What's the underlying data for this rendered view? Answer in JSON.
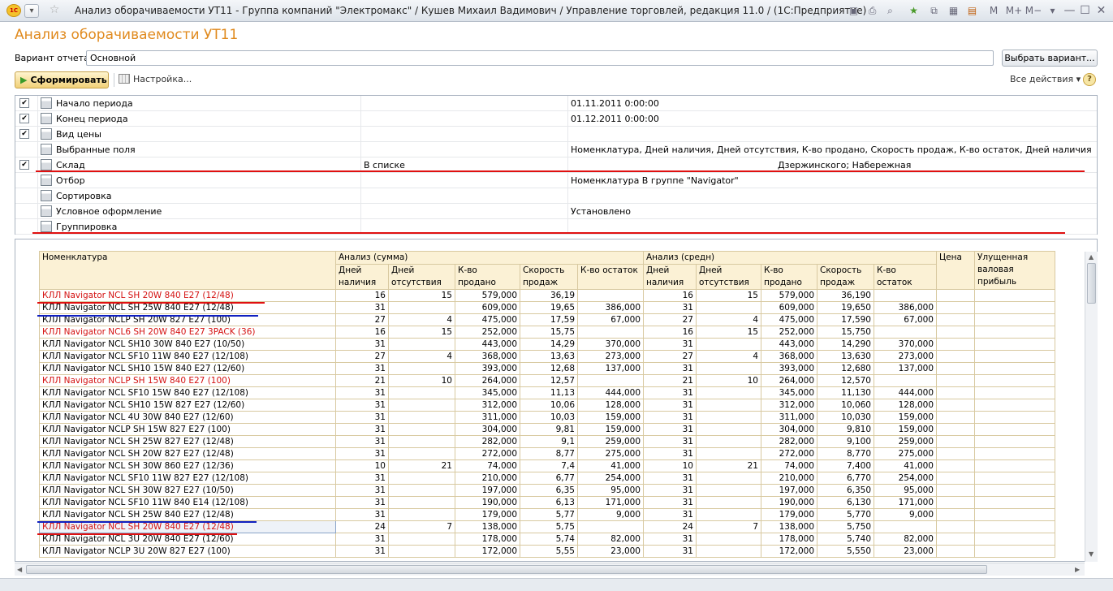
{
  "window": {
    "title": "Анализ оборачиваемости УТ11 - Группа компаний \"Электромакс\" / Кушев Михаил Вадимович / Управление торговлей, редакция 11.0 / (1С:Предприятие)",
    "logo": "1С"
  },
  "form": {
    "heading": "Анализ оборачиваемости УТ11",
    "variant_label": "Вариант отчета:",
    "variant_value": "Основной",
    "choose_variant": "Выбрать вариант...",
    "generate": "Сформировать",
    "setup": "Настройка...",
    "all_actions": "Все действия ▾",
    "help": "?"
  },
  "settings": [
    {
      "checked": true,
      "name": "Начало периода",
      "mid": "",
      "value": "01.11.2011 0:00:00",
      "value2": ""
    },
    {
      "checked": true,
      "name": "Конец периода",
      "mid": "",
      "value": "01.12.2011 0:00:00",
      "value2": ""
    },
    {
      "checked": true,
      "name": "Вид цены",
      "mid": "",
      "value": "",
      "value2": ""
    },
    {
      "checked": null,
      "name": "Выбранные поля",
      "mid": "",
      "value": "Номенклатура, Дней наличия, Дней отсутствия, К-во продано, Скорость продаж, К-во остаток, Дней наличия, Дней отсутст...",
      "value2": ""
    },
    {
      "checked": true,
      "name": "Склад",
      "mid": "В списке",
      "value": "",
      "value2": "Дзержинского; Набережная"
    },
    {
      "checked": null,
      "name": "Отбор",
      "mid": "",
      "value": "Номенклатура В группе \"Navigator\"",
      "value2": ""
    },
    {
      "checked": null,
      "name": "Сортировка",
      "mid": "",
      "value": "",
      "value2": ""
    },
    {
      "checked": null,
      "name": "Условное оформление",
      "mid": "",
      "value": "Установлено",
      "value2": ""
    },
    {
      "checked": null,
      "name": "Группировка",
      "mid": "",
      "value": "",
      "value2": ""
    }
  ],
  "report": {
    "header": {
      "nomenclature": "Номенклатура",
      "group_sum": "Анализ (сумма)",
      "group_avg": "Анализ (средн)",
      "price": "Цена",
      "gross": "Улущенная валовая прибыль",
      "days_in": "Дней наличия",
      "days_out": "Дней отсутствия",
      "sold": "К-во продано",
      "speed": "Скорость продаж",
      "rest": "К-во остаток"
    },
    "rows": [
      {
        "name": "КЛЛ Navigator NCL SH 20W 840 E27 (12/48)",
        "red": true,
        "d1": "16",
        "o1": "15",
        "s1": "579,000",
        "v1": "36,19",
        "r1": "",
        "d2": "16",
        "o2": "15",
        "s2": "579,000",
        "v2": "36,190",
        "r2": ""
      },
      {
        "name": "КЛЛ Navigator NCL SH 25W 840 E27 (12/48)",
        "red": false,
        "d1": "31",
        "o1": "",
        "s1": "609,000",
        "v1": "19,65",
        "r1": "386,000",
        "d2": "31",
        "o2": "",
        "s2": "609,000",
        "v2": "19,650",
        "r2": "386,000"
      },
      {
        "name": "КЛЛ Navigator NCLP SH 20W 827 E27 (100)",
        "red": false,
        "d1": "27",
        "o1": "4",
        "s1": "475,000",
        "v1": "17,59",
        "r1": "67,000",
        "d2": "27",
        "o2": "4",
        "s2": "475,000",
        "v2": "17,590",
        "r2": "67,000"
      },
      {
        "name": "КЛЛ Navigator NCL6 SH 20W 840 E27 3PACK (36)",
        "red": true,
        "d1": "16",
        "o1": "15",
        "s1": "252,000",
        "v1": "15,75",
        "r1": "",
        "d2": "16",
        "o2": "15",
        "s2": "252,000",
        "v2": "15,750",
        "r2": ""
      },
      {
        "name": "КЛЛ Navigator NCL SH10 30W 840 E27 (10/50)",
        "red": false,
        "d1": "31",
        "o1": "",
        "s1": "443,000",
        "v1": "14,29",
        "r1": "370,000",
        "d2": "31",
        "o2": "",
        "s2": "443,000",
        "v2": "14,290",
        "r2": "370,000"
      },
      {
        "name": "КЛЛ Navigator NCL SF10 11W 840 E27 (12/108)",
        "red": false,
        "d1": "27",
        "o1": "4",
        "s1": "368,000",
        "v1": "13,63",
        "r1": "273,000",
        "d2": "27",
        "o2": "4",
        "s2": "368,000",
        "v2": "13,630",
        "r2": "273,000"
      },
      {
        "name": "КЛЛ Navigator NCL SH10 15W 840 E27 (12/60)",
        "red": false,
        "d1": "31",
        "o1": "",
        "s1": "393,000",
        "v1": "12,68",
        "r1": "137,000",
        "d2": "31",
        "o2": "",
        "s2": "393,000",
        "v2": "12,680",
        "r2": "137,000"
      },
      {
        "name": "КЛЛ Navigator NCLP SH 15W 840 E27 (100)",
        "red": true,
        "d1": "21",
        "o1": "10",
        "s1": "264,000",
        "v1": "12,57",
        "r1": "",
        "d2": "21",
        "o2": "10",
        "s2": "264,000",
        "v2": "12,570",
        "r2": ""
      },
      {
        "name": "КЛЛ Navigator NCL SF10 15W 840 E27 (12/108)",
        "red": false,
        "d1": "31",
        "o1": "",
        "s1": "345,000",
        "v1": "11,13",
        "r1": "444,000",
        "d2": "31",
        "o2": "",
        "s2": "345,000",
        "v2": "11,130",
        "r2": "444,000"
      },
      {
        "name": "КЛЛ Navigator NCL SH10 15W 827 E27 (12/60)",
        "red": false,
        "d1": "31",
        "o1": "",
        "s1": "312,000",
        "v1": "10,06",
        "r1": "128,000",
        "d2": "31",
        "o2": "",
        "s2": "312,000",
        "v2": "10,060",
        "r2": "128,000"
      },
      {
        "name": "КЛЛ Navigator NCL 4U 30W 840 E27 (12/60)",
        "red": false,
        "d1": "31",
        "o1": "",
        "s1": "311,000",
        "v1": "10,03",
        "r1": "159,000",
        "d2": "31",
        "o2": "",
        "s2": "311,000",
        "v2": "10,030",
        "r2": "159,000"
      },
      {
        "name": "КЛЛ Navigator NCLP SH 15W 827 E27 (100)",
        "red": false,
        "d1": "31",
        "o1": "",
        "s1": "304,000",
        "v1": "9,81",
        "r1": "159,000",
        "d2": "31",
        "o2": "",
        "s2": "304,000",
        "v2": "9,810",
        "r2": "159,000"
      },
      {
        "name": "КЛЛ Navigator NCL SH 25W 827 E27 (12/48)",
        "red": false,
        "d1": "31",
        "o1": "",
        "s1": "282,000",
        "v1": "9,1",
        "r1": "259,000",
        "d2": "31",
        "o2": "",
        "s2": "282,000",
        "v2": "9,100",
        "r2": "259,000"
      },
      {
        "name": "КЛЛ Navigator NCL SH 20W 827 E27 (12/48)",
        "red": false,
        "d1": "31",
        "o1": "",
        "s1": "272,000",
        "v1": "8,77",
        "r1": "275,000",
        "d2": "31",
        "o2": "",
        "s2": "272,000",
        "v2": "8,770",
        "r2": "275,000"
      },
      {
        "name": "КЛЛ Navigator NCL SH 30W 860 E27 (12/36)",
        "red": false,
        "d1": "10",
        "o1": "21",
        "s1": "74,000",
        "v1": "7,4",
        "r1": "41,000",
        "d2": "10",
        "o2": "21",
        "s2": "74,000",
        "v2": "7,400",
        "r2": "41,000"
      },
      {
        "name": "КЛЛ Navigator NCL SF10 11W 827 E27 (12/108)",
        "red": false,
        "d1": "31",
        "o1": "",
        "s1": "210,000",
        "v1": "6,77",
        "r1": "254,000",
        "d2": "31",
        "o2": "",
        "s2": "210,000",
        "v2": "6,770",
        "r2": "254,000"
      },
      {
        "name": "КЛЛ Navigator NCL SH 30W 827 E27 (10/50)",
        "red": false,
        "d1": "31",
        "o1": "",
        "s1": "197,000",
        "v1": "6,35",
        "r1": "95,000",
        "d2": "31",
        "o2": "",
        "s2": "197,000",
        "v2": "6,350",
        "r2": "95,000"
      },
      {
        "name": "КЛЛ Navigator NCL SF10 11W 840 E14 (12/108)",
        "red": false,
        "d1": "31",
        "o1": "",
        "s1": "190,000",
        "v1": "6,13",
        "r1": "171,000",
        "d2": "31",
        "o2": "",
        "s2": "190,000",
        "v2": "6,130",
        "r2": "171,000"
      },
      {
        "name": "КЛЛ Navigator NCL SH 25W 840 E27 (12/48)",
        "red": false,
        "d1": "31",
        "o1": "",
        "s1": "179,000",
        "v1": "5,77",
        "r1": "9,000",
        "d2": "31",
        "o2": "",
        "s2": "179,000",
        "v2": "5,770",
        "r2": "9,000"
      },
      {
        "name": "КЛЛ Navigator NCL SH 20W 840 E27 (12/48)",
        "red": true,
        "hl": true,
        "d1": "24",
        "o1": "7",
        "s1": "138,000",
        "v1": "5,75",
        "r1": "",
        "d2": "24",
        "o2": "7",
        "s2": "138,000",
        "v2": "5,750",
        "r2": ""
      },
      {
        "name": "КЛЛ Navigator NCL 3U 20W 840 E27 (12/60)",
        "red": false,
        "d1": "31",
        "o1": "",
        "s1": "178,000",
        "v1": "5,74",
        "r1": "82,000",
        "d2": "31",
        "o2": "",
        "s2": "178,000",
        "v2": "5,740",
        "r2": "82,000"
      },
      {
        "name": "КЛЛ Navigator NCLP 3U 20W 827 E27 (100)",
        "red": false,
        "d1": "31",
        "o1": "",
        "s1": "172,000",
        "v1": "5,55",
        "r1": "23,000",
        "d2": "31",
        "o2": "",
        "s2": "172,000",
        "v2": "5,550",
        "r2": "23,000"
      }
    ]
  }
}
